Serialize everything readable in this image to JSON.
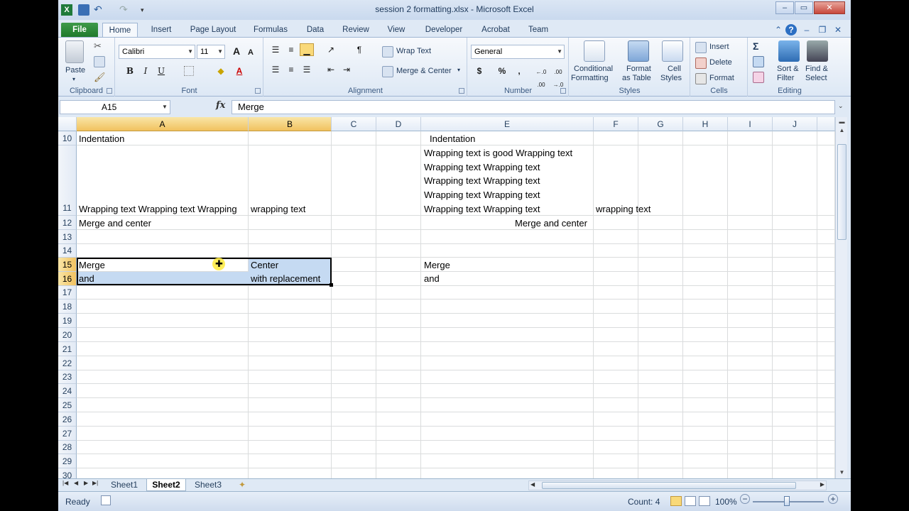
{
  "window": {
    "title": "session 2 formatting.xlsx  -  Microsoft Excel",
    "controls": {
      "minimize": "–",
      "restore": "▭",
      "close": "✕"
    }
  },
  "tabs": [
    "File",
    "Home",
    "Insert",
    "Page Layout",
    "Formulas",
    "Data",
    "Review",
    "View",
    "Developer",
    "Acrobat",
    "Team"
  ],
  "ribbon": {
    "clipboard": {
      "label": "Clipboard",
      "paste": "Paste"
    },
    "font": {
      "label": "Font",
      "name": "Calibri",
      "size": "11",
      "bold": "B",
      "italic": "I",
      "underline": "U",
      "grow": "A",
      "shrink": "A",
      "font_color_glyph": "A"
    },
    "alignment": {
      "label": "Alignment",
      "wrap_text": "Wrap Text",
      "merge_center": "Merge & Center"
    },
    "number": {
      "label": "Number",
      "format": "General",
      "currency": "$",
      "percent": "%",
      "comma": ",",
      "inc_dec": "←.0 .00",
      "dec_dec": ".00 →.0"
    },
    "styles": {
      "label": "Styles",
      "conditional": "Conditional Formatting",
      "conditional_1": "Conditional",
      "conditional_2": "Formatting",
      "format_table_1": "Format",
      "format_table_2": "as Table",
      "cell_styles_1": "Cell",
      "cell_styles_2": "Styles"
    },
    "cells": {
      "label": "Cells",
      "insert": "Insert",
      "delete": "Delete",
      "format": "Format"
    },
    "editing": {
      "label": "Editing",
      "sigma": "Σ",
      "sort_1": "Sort &",
      "sort_2": "Filter",
      "find_1": "Find &",
      "find_2": "Select"
    }
  },
  "formula_bar": {
    "name_box": "A15",
    "fx": "fx",
    "content": "Merge"
  },
  "columns": [
    "A",
    "B",
    "C",
    "D",
    "E",
    "F",
    "G",
    "H",
    "I",
    "J"
  ],
  "selected_columns": [
    "A",
    "B"
  ],
  "rows": [
    "10",
    "11",
    "12",
    "13",
    "14",
    "15",
    "16",
    "17",
    "18",
    "19",
    "20",
    "21",
    "22",
    "23",
    "24",
    "25",
    "26",
    "27",
    "28",
    "29",
    "30"
  ],
  "selected_rows": [
    "15",
    "16"
  ],
  "cells": {
    "A10": "Indentation",
    "E10": "Indentation",
    "E11_lines": [
      "Wrapping text is good Wrapping text",
      "Wrapping text Wrapping text",
      "Wrapping text Wrapping text",
      "Wrapping text Wrapping text",
      "Wrapping text Wrapping text"
    ],
    "A11": "Wrapping text Wrapping text Wrapping",
    "B11": "wrapping text",
    "F11": "wrapping text",
    "A12": "Merge and center",
    "E12": "Merge and center",
    "A15": "Merge",
    "B15": "Center",
    "E15": "Merge",
    "A16": "and",
    "B16": "with replacement",
    "E16": "and"
  },
  "sheets": [
    "Sheet1",
    "Sheet2",
    "Sheet3"
  ],
  "active_sheet": "Sheet2",
  "status": {
    "ready": "Ready",
    "count": "Count: 4",
    "zoom": "100%",
    "zoom_out": "−",
    "zoom_in": "+"
  }
}
